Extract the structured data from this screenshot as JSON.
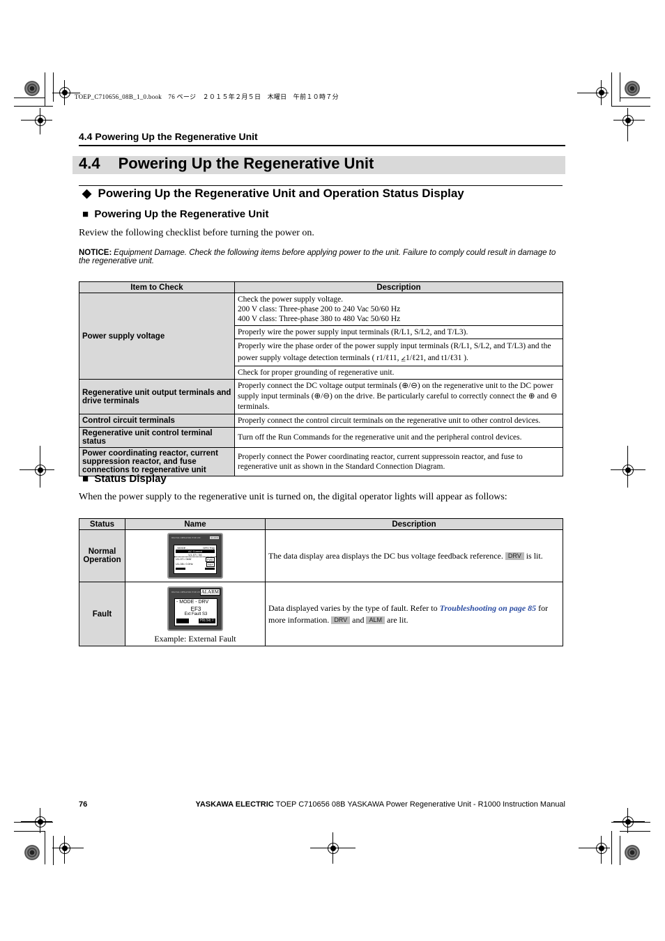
{
  "print_header": "TOEP_C710656_08B_1_0.book　76 ページ　２０１５年２月５日　木曜日　午前１０時７分",
  "running_head": "4.4  Powering Up the Regenerative Unit",
  "section": {
    "number": "4.4",
    "title": "Powering Up the Regenerative Unit"
  },
  "subsection": {
    "marker": "◆",
    "title": "Powering Up the Regenerative Unit and Operation Status Display"
  },
  "heading_powerup": {
    "marker": "■",
    "title": "Powering Up the Regenerative Unit"
  },
  "intro_text": "Review the following checklist before turning the power on.",
  "notice": {
    "label": "NOTICE:",
    "text": "Equipment Damage. Check the following items before applying power to the unit. Failure to comply could result in damage to the regenerative unit."
  },
  "checklist": {
    "headers": [
      "Item to Check",
      "Description"
    ],
    "rows": [
      {
        "item": "Power supply voltage",
        "descriptions": [
          [
            "Check the power supply voltage.",
            "200 V class: Three-phase 200 to 240 Vac 50/60 Hz",
            "400 V class: Three-phase 380 to 480 Vac 50/60 Hz"
          ],
          [
            "Properly wire the power supply input terminals (R/L1, S/L2, and T/L3)."
          ],
          [
            "Properly wire the phase order of the power supply input terminals (R/L1, S/L2, and T/L3) and the power supply voltage detection terminals ( r1/ℓ11, ⦤1/ℓ21, and t1/ℓ31 )."
          ],
          [
            "Check for proper grounding of regenerative unit."
          ]
        ]
      },
      {
        "item": "Regenerative unit output terminals and drive terminals",
        "descriptions": [
          [
            "Properly connect the DC voltage output terminals (⊕/⊖) on the regenerative unit to the DC power supply input terminals (⊕/⊖) on the drive. Be particularly careful to correctly connect the ⊕ and ⊖ terminals."
          ]
        ]
      },
      {
        "item": "Control circuit terminals",
        "descriptions": [
          [
            "Properly connect the control circuit terminals on the regenerative unit to other control devices."
          ]
        ]
      },
      {
        "item": "Regenerative unit control terminal status",
        "descriptions": [
          [
            "Turn off the Run Commands for the regenerative unit and the peripheral control devices."
          ]
        ]
      },
      {
        "item": "Power coordinating reactor, current suppression reactor, and fuse connections to regenerative unit",
        "descriptions": [
          [
            "Properly connect the Power coordinating reactor, current suppressoin reactor, and fuse to regenerative unit as shown in the Standard Connection Diagram."
          ]
        ]
      }
    ]
  },
  "heading_status": {
    "marker": "■",
    "title": "Status Display"
  },
  "status_intro": "When the power supply to the regenerative unit is turned on, the digital operator lights will appear as follows:",
  "status_table": {
    "headers": [
      "Status",
      "Name",
      "Description"
    ],
    "rows": [
      {
        "status": "Normal Operation",
        "display": {
          "top_label": "DIGITAL OPERATOR JVOP-180",
          "indicator": "ALARM",
          "mode_line": "- MODE -",
          "mode_right": "DRV   Rdy",
          "title_bar": "AC Current",
          "line1": "U1-07= 0A",
          "line2": "U1-07= 0kW",
          "line3": "U1-08= 0.0Hz",
          "key1": "FWD",
          "key2": "REF"
        },
        "caption": "",
        "description_parts": [
          "The data display area displays the DC bus voltage feedback reference. ",
          " is lit."
        ],
        "badges": [
          "DRV"
        ]
      },
      {
        "status": "Fault",
        "display": {
          "top_label": "DIGITAL OPERATOR JVOP-180",
          "indicator": "ALARM",
          "mode_line": "- MODE -   DRV",
          "code": "EF3",
          "message": "Ext Fault S3",
          "key": "RESET"
        },
        "caption": "Example: External Fault",
        "description_parts": [
          "Data displayed varies by the type of fault. Refer to ",
          " for more information. ",
          " and ",
          " are lit."
        ],
        "link": "Troubleshooting on page 85",
        "badges": [
          "DRV",
          "ALM"
        ]
      }
    ]
  },
  "footer": {
    "page_number": "76",
    "brand": "YASKAWA ELECTRIC",
    "doc": " TOEP C710656 08B YASKAWA Power Regenerative Unit - R1000 Instruction Manual"
  }
}
